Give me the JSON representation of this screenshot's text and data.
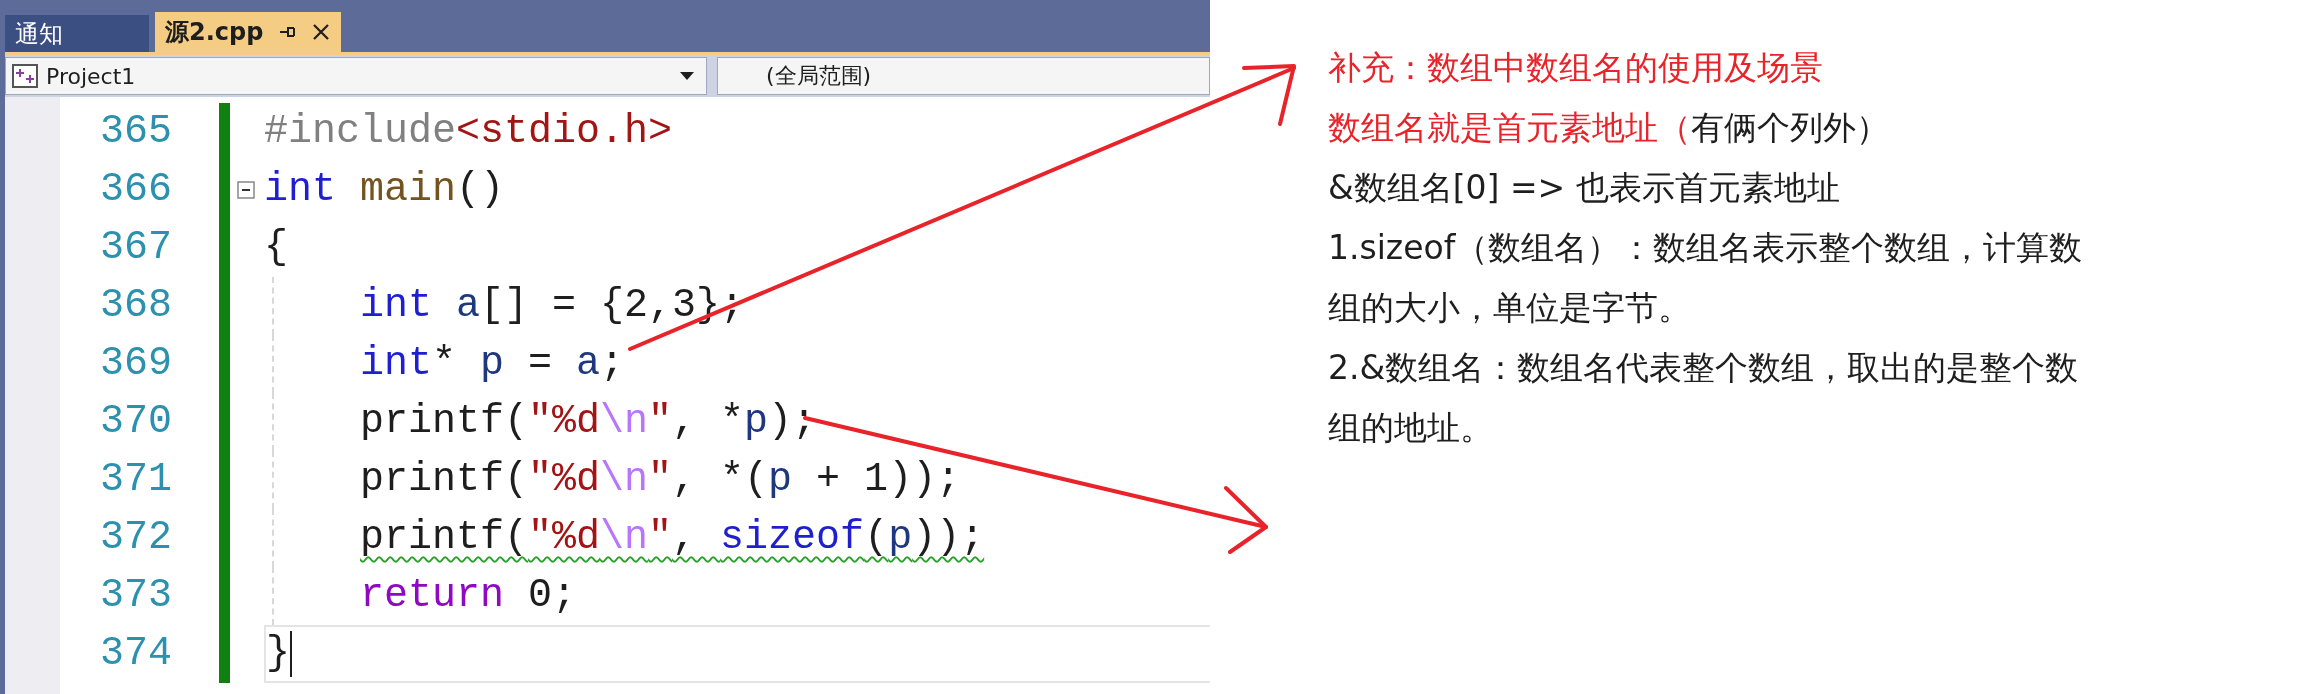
{
  "tabs": [
    {
      "label": "通知",
      "selected": false
    },
    {
      "label": "源2.cpp",
      "selected": true
    }
  ],
  "nav_bar": {
    "project": "Project1",
    "scope": "(全局范围)"
  },
  "editor": {
    "lines": [
      {
        "number": "365",
        "modified": true,
        "collapsible": false,
        "indented": false,
        "warning": false,
        "current": false,
        "tokens": [
          {
            "kind": "preproc",
            "text": "#include"
          },
          {
            "kind": "header",
            "text": "<stdio.h>"
          }
        ]
      },
      {
        "number": "366",
        "modified": true,
        "collapsible": true,
        "indented": false,
        "warning": false,
        "current": false,
        "tokens": [
          {
            "kind": "keyword",
            "text": "int"
          },
          {
            "kind": "function",
            "text": " main"
          },
          {
            "kind": "plain",
            "text": "()"
          }
        ]
      },
      {
        "number": "367",
        "modified": true,
        "collapsible": false,
        "indented": false,
        "warning": false,
        "current": false,
        "tokens": [
          {
            "kind": "plain",
            "text": "{"
          }
        ]
      },
      {
        "number": "368",
        "modified": true,
        "collapsible": false,
        "indented": true,
        "warning": false,
        "current": false,
        "tokens": [
          {
            "kind": "keyword",
            "text": "int"
          },
          {
            "kind": "variable",
            "text": " a"
          },
          {
            "kind": "plain",
            "text": "[] = {2,3};"
          }
        ]
      },
      {
        "number": "369",
        "modified": true,
        "collapsible": false,
        "indented": true,
        "warning": false,
        "current": false,
        "tokens": [
          {
            "kind": "keyword",
            "text": "int"
          },
          {
            "kind": "plain",
            "text": "* "
          },
          {
            "kind": "variable",
            "text": "p"
          },
          {
            "kind": "plain",
            "text": " = "
          },
          {
            "kind": "variable",
            "text": "a"
          },
          {
            "kind": "plain",
            "text": ";"
          }
        ]
      },
      {
        "number": "370",
        "modified": true,
        "collapsible": false,
        "indented": true,
        "warning": false,
        "current": false,
        "tokens": [
          {
            "kind": "plain",
            "text": "printf("
          },
          {
            "kind": "string",
            "text": "\"%d"
          },
          {
            "kind": "escape",
            "text": "\\n"
          },
          {
            "kind": "string",
            "text": "\""
          },
          {
            "kind": "plain",
            "text": ", *"
          },
          {
            "kind": "variable",
            "text": "p"
          },
          {
            "kind": "plain",
            "text": ");"
          }
        ]
      },
      {
        "number": "371",
        "modified": true,
        "collapsible": false,
        "indented": true,
        "warning": false,
        "current": false,
        "tokens": [
          {
            "kind": "plain",
            "text": "printf("
          },
          {
            "kind": "string",
            "text": "\"%d"
          },
          {
            "kind": "escape",
            "text": "\\n"
          },
          {
            "kind": "string",
            "text": "\""
          },
          {
            "kind": "plain",
            "text": ", *("
          },
          {
            "kind": "variable",
            "text": "p"
          },
          {
            "kind": "plain",
            "text": " + 1));"
          }
        ]
      },
      {
        "number": "372",
        "modified": true,
        "collapsible": false,
        "indented": true,
        "warning": true,
        "current": false,
        "tokens": [
          {
            "kind": "plain",
            "text": "printf("
          },
          {
            "kind": "string",
            "text": "\"%d"
          },
          {
            "kind": "escape",
            "text": "\\n"
          },
          {
            "kind": "string",
            "text": "\""
          },
          {
            "kind": "plain",
            "text": ", "
          },
          {
            "kind": "keyword",
            "text": "sizeof"
          },
          {
            "kind": "plain",
            "text": "("
          },
          {
            "kind": "variable",
            "text": "p"
          },
          {
            "kind": "plain",
            "text": "));"
          }
        ]
      },
      {
        "number": "373",
        "modified": true,
        "collapsible": false,
        "indented": true,
        "warning": false,
        "current": false,
        "tokens": [
          {
            "kind": "control",
            "text": "return"
          },
          {
            "kind": "plain",
            "text": " 0;"
          }
        ]
      },
      {
        "number": "374",
        "modified": true,
        "collapsible": false,
        "indented": false,
        "warning": false,
        "current": true,
        "tokens": [
          {
            "kind": "plain",
            "text": "}"
          }
        ]
      }
    ]
  },
  "notes": [
    {
      "lines": [
        [
          {
            "text": "补充：数组中数组名的使用及场景",
            "highlighted": true
          }
        ]
      ]
    },
    {
      "lines": [
        [
          {
            "text": "数组名就是首元素地址（",
            "highlighted": true
          },
          {
            "text": "有俩个列外）",
            "highlighted": false
          }
        ]
      ]
    },
    {
      "lines": [
        [
          {
            "text": "&数组名[0] => 也表示首元素地址",
            "highlighted": false
          }
        ]
      ]
    },
    {
      "lines": [
        [
          {
            "text": "1.sizeof（数组名）：数组名表示整个数组，计算数",
            "highlighted": false
          }
        ],
        [
          {
            "text": "组的大小，单位是字节。",
            "highlighted": false
          }
        ]
      ]
    },
    {
      "lines": [
        [
          {
            "text": "2.&数组名：数组名代表整个数组，取出的是整个数",
            "highlighted": false
          }
        ],
        [
          {
            "text": "组的地址。",
            "highlighted": false
          }
        ]
      ]
    }
  ]
}
